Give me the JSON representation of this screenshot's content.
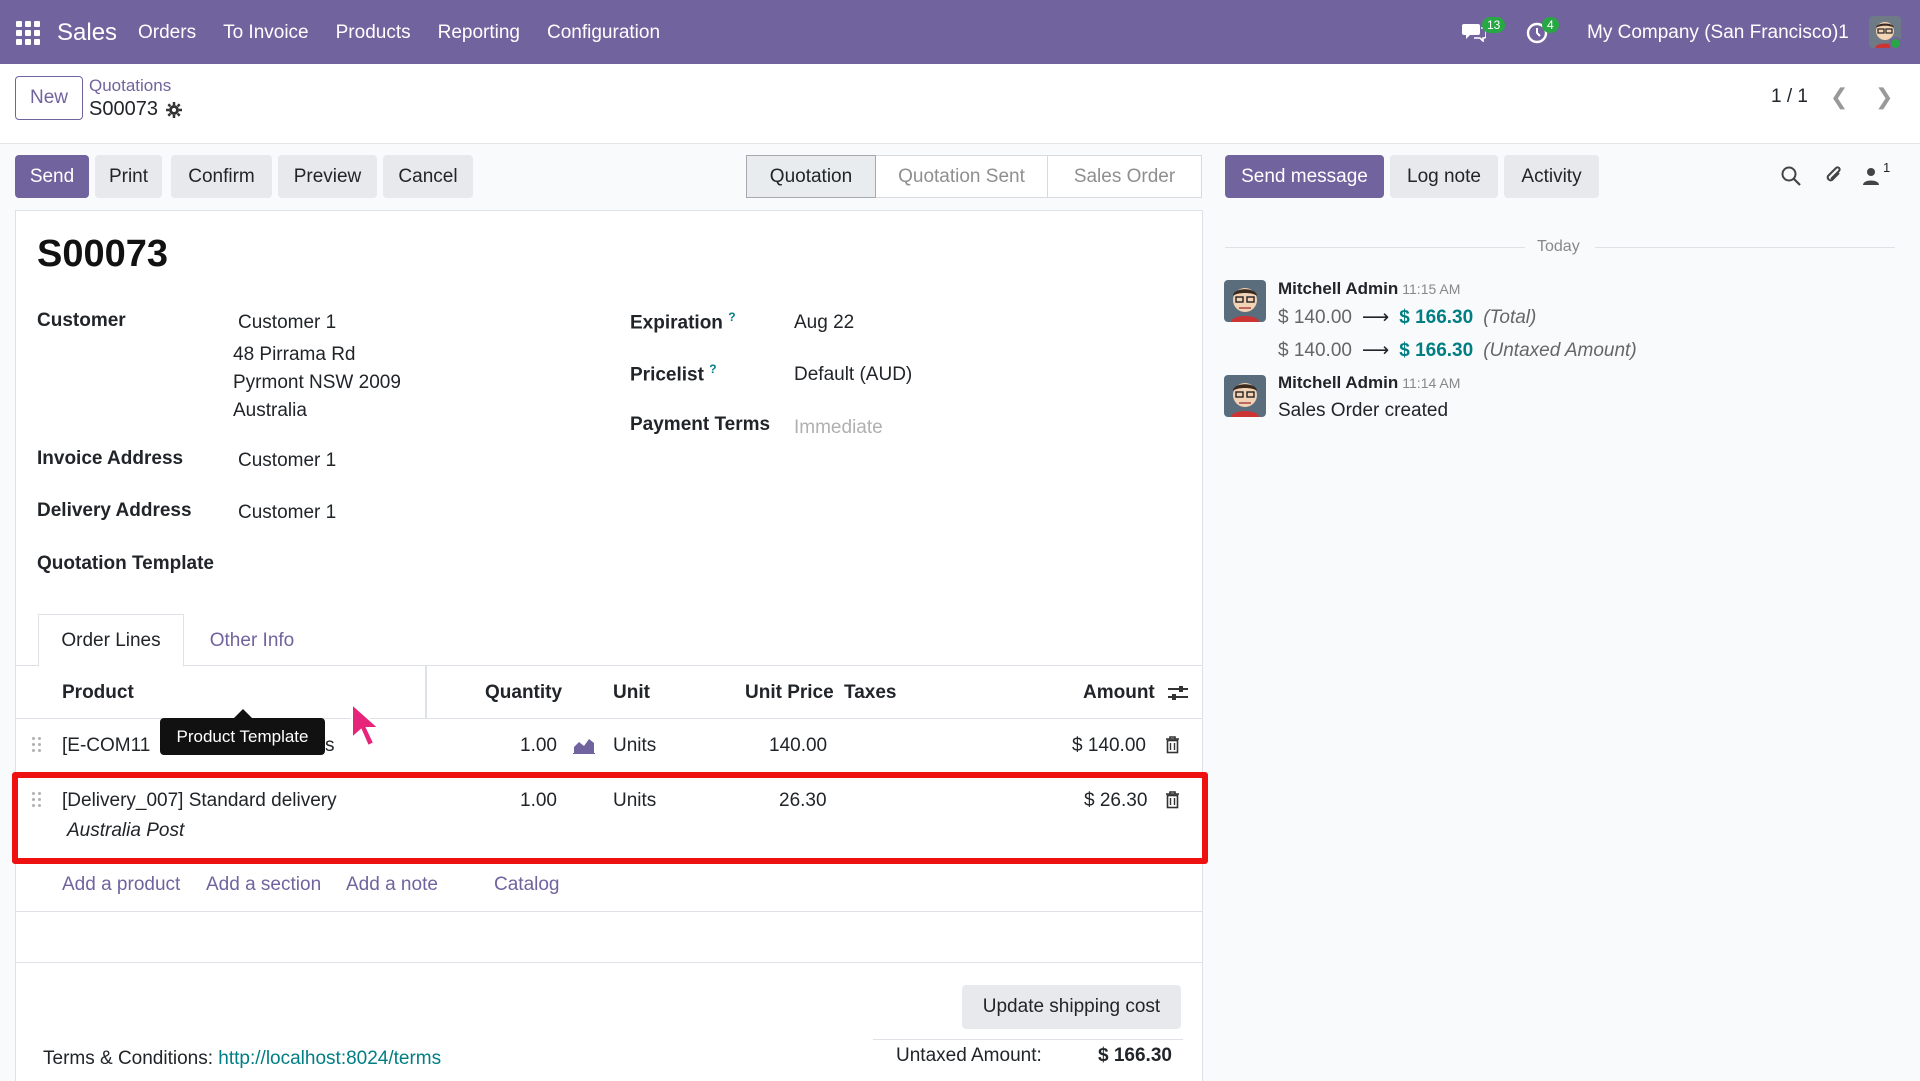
{
  "nav": {
    "app": "Sales",
    "menu": [
      "Orders",
      "To Invoice",
      "Products",
      "Reporting",
      "Configuration"
    ],
    "messages_count": "13",
    "activities_count": "4",
    "company": "My Company (San Francisco)1"
  },
  "control": {
    "new_label": "New",
    "breadcrumb": "Quotations",
    "record": "S00073",
    "pager": "1 / 1"
  },
  "actions": {
    "send": "Send",
    "print": "Print",
    "confirm": "Confirm",
    "preview": "Preview",
    "cancel": "Cancel"
  },
  "status": [
    "Quotation",
    "Quotation Sent",
    "Sales Order"
  ],
  "form": {
    "title": "S00073",
    "customer_label": "Customer",
    "customer_name": "Customer 1",
    "customer_addr1": "48 Pirrama Rd",
    "customer_addr2": "Pyrmont NSW 2009",
    "customer_addr3": "Australia",
    "invoice_label": "Invoice Address",
    "invoice_value": "Customer 1",
    "delivery_label": "Delivery Address",
    "delivery_value": "Customer 1",
    "template_label": "Quotation Template",
    "expiration_label": "Expiration",
    "expiration_value": "Aug 22",
    "pricelist_label": "Pricelist",
    "pricelist_value": "Default (AUD)",
    "terms_label": "Payment Terms",
    "terms_placeholder": "Immediate",
    "help_mark": "?"
  },
  "tabs": [
    "Order Lines",
    "Other Info"
  ],
  "table": {
    "headers": [
      "Product",
      "Quantity",
      "Unit",
      "Unit Price",
      "Taxes",
      "Amount"
    ],
    "rows": [
      {
        "product_start": "[E-COM11",
        "product_end": "s",
        "qty": "1.00",
        "unit": "Units",
        "price": "140.00",
        "amount": "$ 140.00"
      },
      {
        "product": "[Delivery_007] Standard delivery",
        "desc": "Australia Post",
        "qty": "1.00",
        "unit": "Units",
        "price": "26.30",
        "amount": "$ 26.30"
      }
    ],
    "add_product": "Add a product",
    "add_section": "Add a section",
    "add_note": "Add a note",
    "catalog": "Catalog",
    "tooltip": "Product Template"
  },
  "footer": {
    "update_shipping": "Update shipping cost",
    "terms_label": "Terms & Conditions:",
    "terms_link": "http://localhost:8024/terms",
    "untaxed_label": "Untaxed Amount:",
    "untaxed_value": "$ 166.30"
  },
  "chatter": {
    "send_message": "Send message",
    "log_note": "Log note",
    "activity": "Activity",
    "followers_count": "1",
    "today": "Today",
    "messages": [
      {
        "author": "Mitchell Admin",
        "time": "11:15 AM",
        "tracking": [
          {
            "old": "$ 140.00",
            "new": "$ 166.30",
            "field": "(Total)"
          },
          {
            "old": "$ 140.00",
            "new": "$ 166.30",
            "field": "(Untaxed Amount)"
          }
        ]
      },
      {
        "author": "Mitchell Admin",
        "time": "11:14 AM",
        "body": "Sales Order created"
      }
    ]
  },
  "colors": {
    "brand": "#71639e",
    "link": "#017e84",
    "highlight": "#ee1111",
    "badge": "#28a745"
  }
}
